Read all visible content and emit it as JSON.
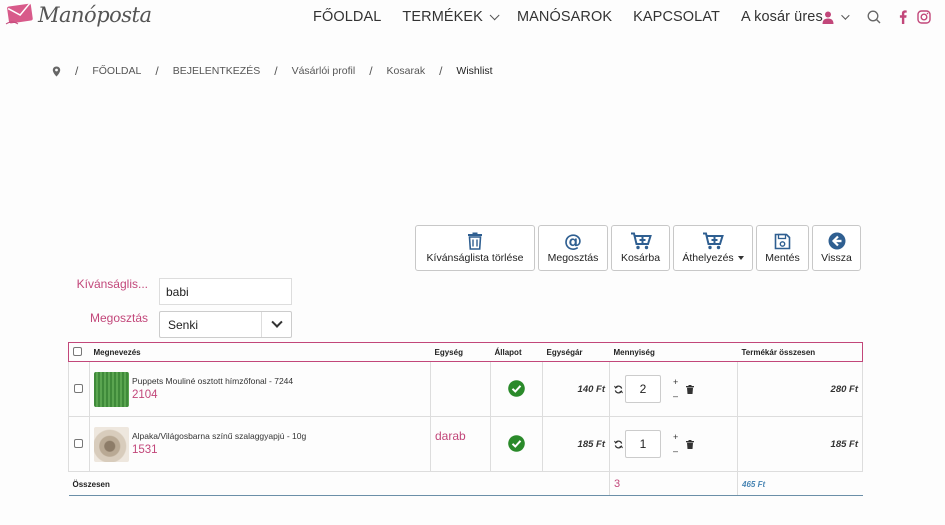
{
  "brand": {
    "name": "Manóposta",
    "accent": "#c2477a"
  },
  "nav": {
    "items": [
      {
        "label": "FŐOLDAL"
      },
      {
        "label": "TERMÉKEK"
      },
      {
        "label": "MANÓSAROK"
      },
      {
        "label": "KAPCSOLAT"
      },
      {
        "label": "A kosár üres"
      }
    ],
    "icons": [
      "user-icon",
      "search-icon",
      "facebook-icon",
      "instagram-icon"
    ]
  },
  "breadcrumb": {
    "items": [
      "FŐOLDAL",
      "BEJELENTKEZÉS",
      "Vásárlói profil",
      "Kosarak",
      "Wishlist"
    ],
    "separator": "/"
  },
  "toolbar": {
    "delete_label": "Kívánságlista törlése",
    "share_label": "Megosztás",
    "cart_label": "Kosárba",
    "move_label": "Áthelyezés",
    "save_label": "Mentés",
    "back_label": "Vissza"
  },
  "form": {
    "name_label": "Kívánságlis...",
    "name_value": "babi",
    "share_label": "Megosztás",
    "share_value": "Senki"
  },
  "table": {
    "headers": [
      "Megnevezés",
      "Egység",
      "Állapot",
      "Egységár",
      "Mennyiség",
      "Termékár összesen"
    ],
    "rows": [
      {
        "name": "Puppets Mouliné osztott hímzőfonal - 7244",
        "code": "2104",
        "unit": "",
        "unit_price": "140 Ft",
        "quantity": "2",
        "total": "280 Ft",
        "thumb_color": "#4e9a46"
      },
      {
        "name": "Alpaka/Világosbarna színű szalaggyapjú - 10g",
        "code": "1531",
        "unit": "darab",
        "unit_price": "185 Ft",
        "quantity": "1",
        "total": "185 Ft",
        "thumb_color": "#b9a994"
      }
    ],
    "footer": {
      "label": "Összesen",
      "quantity": "3",
      "total": "465 Ft"
    },
    "plus": "+",
    "minus": "–"
  }
}
